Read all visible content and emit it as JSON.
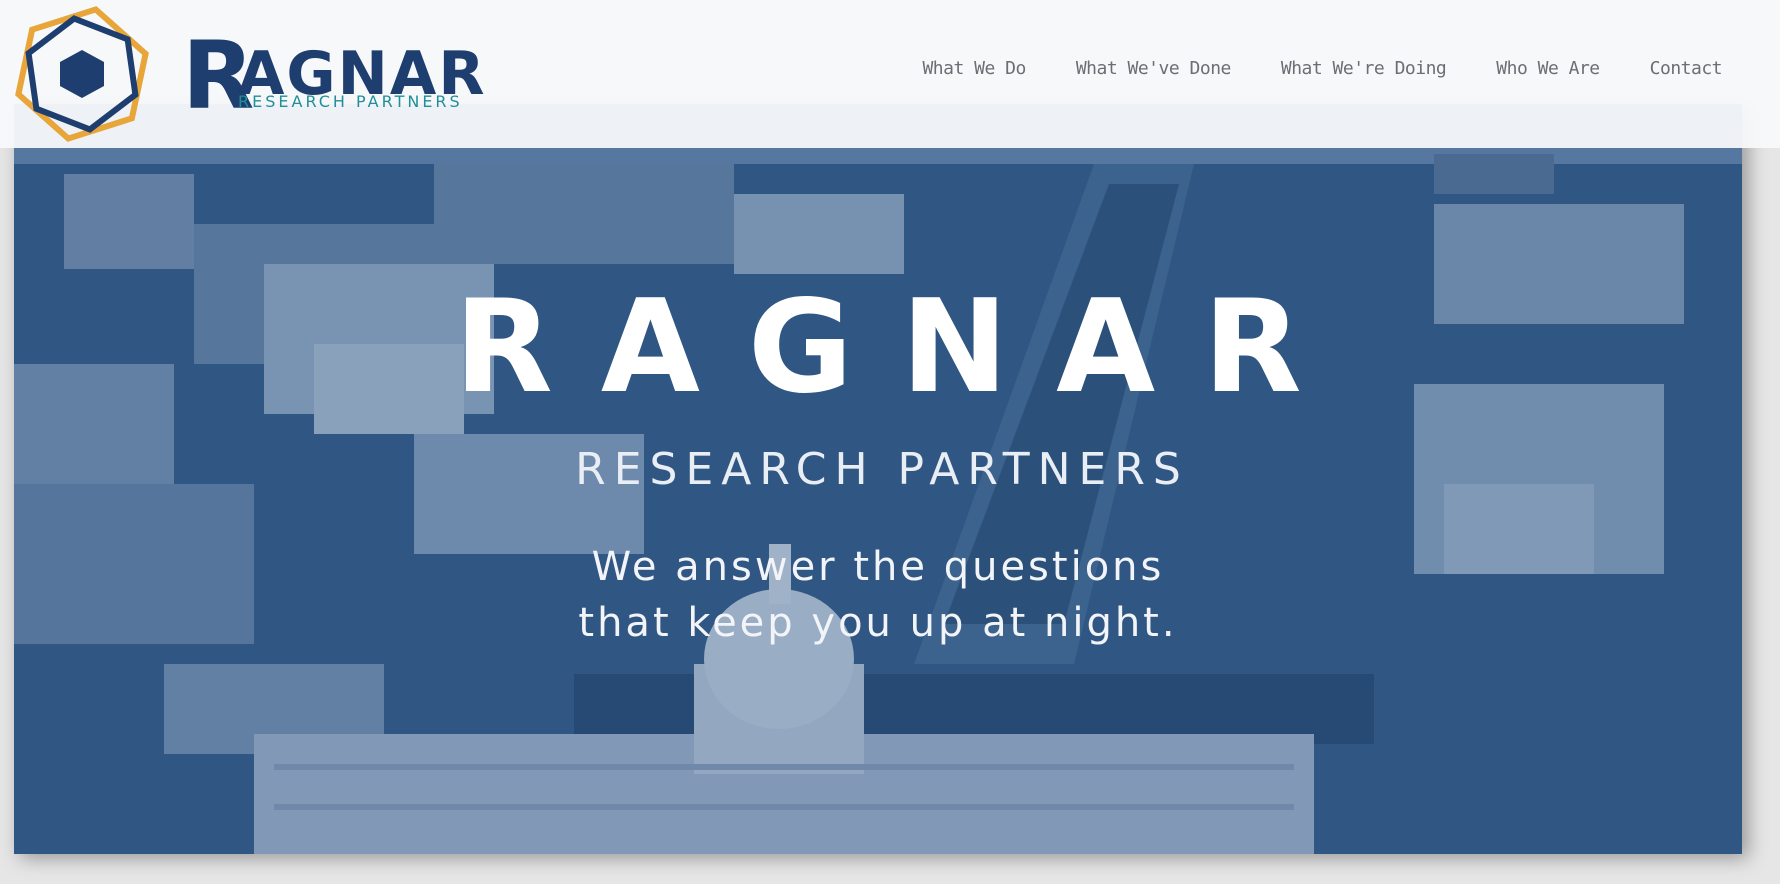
{
  "brand": {
    "logo_name": "RAGNAR",
    "logo_initial": "R",
    "logo_rest": "AGNAR",
    "logo_subtitle": "RESEARCH PARTNERS",
    "colors": {
      "navy": "#1d3e6e",
      "teal": "#1f8f9a",
      "gold": "#e8a53a"
    }
  },
  "nav": {
    "items": [
      {
        "label": "What We Do"
      },
      {
        "label": "What We've Done"
      },
      {
        "label": "What We're Doing"
      },
      {
        "label": "Who We Are"
      },
      {
        "label": "Contact"
      }
    ]
  },
  "hero": {
    "title": "RAGNAR",
    "subtitle": "RESEARCH PARTNERS",
    "tagline_line1": "We answer the questions",
    "tagline_line2": "that keep you up at night.",
    "image_subject": "aerial-city-photo",
    "overlay_color": "#1d4a7e"
  }
}
